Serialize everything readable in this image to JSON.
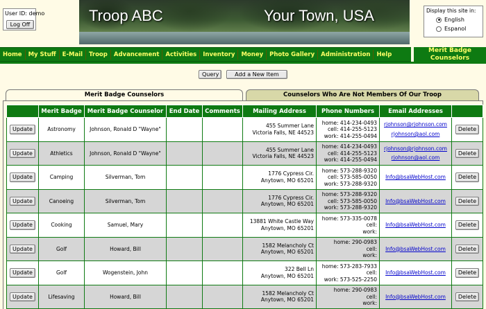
{
  "user": {
    "id_label": "User ID: demo",
    "logoff_label": "Log Off"
  },
  "banner": {
    "left_text": "Troop ABC",
    "right_text": "Your Town, USA"
  },
  "language": {
    "title": "Display this site in:",
    "options": [
      {
        "label": "English",
        "selected": true
      },
      {
        "label": "Espanol",
        "selected": false
      }
    ]
  },
  "nav": [
    "Home",
    "My Stuff",
    "E-Mail",
    "Troop",
    "Advancement",
    "Activities",
    "Inventory",
    "Money",
    "Photo Gallery",
    "Administration",
    "Help"
  ],
  "page_title": "Merit Badge Counselors",
  "actions": {
    "query_label": "Query",
    "add_label": "Add a New Item"
  },
  "tabs": [
    {
      "label": "Merit Badge Counselors",
      "active": true
    },
    {
      "label": "Counselors Who Are Not Members Of Our Troop",
      "active": false
    }
  ],
  "table": {
    "columns": [
      "",
      "Merit Badge",
      "Merit Badge Counselor",
      "End Date",
      "Comments",
      "Mailing Address",
      "Phone Numbers",
      "Email Addresses",
      ""
    ],
    "update_label": "Update",
    "delete_label": "Delete",
    "rows": [
      {
        "badge": "Astronomy",
        "counselor": "Johnson, Ronald D \"Wayne\"",
        "end_date": "",
        "comments": "",
        "addr1": "455 Summer Lane",
        "addr2": "Victoria Falls, NE  44523",
        "phones": [
          "home: 414-234-0493",
          "cell: 414-255-5123",
          "work: 414-255-0494"
        ],
        "emails": [
          "rjohnson@rjohnson.com",
          "rjohnson@aol.com"
        ]
      },
      {
        "badge": "Athletics",
        "counselor": "Johnson, Ronald D \"Wayne\"",
        "end_date": "",
        "comments": "",
        "addr1": "455 Summer Lane",
        "addr2": "Victoria Falls, NE  44523",
        "phones": [
          "home: 414-234-0493",
          "cell: 414-255-5123",
          "work: 414-255-0494"
        ],
        "emails": [
          "rjohnson@rjohnson.com",
          "rjohnson@aol.com"
        ]
      },
      {
        "badge": "Camping",
        "counselor": "Silverman, Tom",
        "end_date": "",
        "comments": "",
        "addr1": "1776 Cypress Cir.",
        "addr2": "Anytown, MO  65201",
        "phones": [
          "home: 573-288-9320",
          "cell: 573-585-0050",
          "work: 573-288-9320"
        ],
        "emails": [
          "Info@bsaWebHost.com"
        ]
      },
      {
        "badge": "Canoeing",
        "counselor": "Silverman, Tom",
        "end_date": "",
        "comments": "",
        "addr1": "1776 Cypress Cir.",
        "addr2": "Anytown, MO  65201",
        "phones": [
          "home: 573-288-9320",
          "cell: 573-585-0050",
          "work: 573-288-9320"
        ],
        "emails": [
          "Info@bsaWebHost.com"
        ]
      },
      {
        "badge": "Cooking",
        "counselor": "Samuel, Mary",
        "end_date": "",
        "comments": "",
        "addr1": "13881 White Castle Way",
        "addr2": "Anytown, MO  65201",
        "phones": [
          "home: 573-335-0078",
          "cell:",
          "work:"
        ],
        "emails": [
          "Info@bsaWebHost.com"
        ]
      },
      {
        "badge": "Golf",
        "counselor": "Howard, Bill",
        "end_date": "",
        "comments": "",
        "addr1": "1582 Melancholy Ct",
        "addr2": "Anytown, MO  65201",
        "phones": [
          "home: 290-0983",
          "cell:",
          "work:"
        ],
        "emails": [
          "Info@bsaWebHost.com"
        ]
      },
      {
        "badge": "Golf",
        "counselor": "Wogenstein, John",
        "end_date": "",
        "comments": "",
        "addr1": "322 Bell Ln",
        "addr2": "Anytown, MO  65201",
        "phones": [
          "home: 573-283-7933",
          "cell:",
          "work: 573-525-2250"
        ],
        "emails": [
          "Info@bsaWebHost.com"
        ]
      },
      {
        "badge": "Lifesaving",
        "counselor": "Howard, Bill",
        "end_date": "",
        "comments": "",
        "addr1": "1582 Melancholy Ct",
        "addr2": "Anytown, MO  65201",
        "phones": [
          "home: 290-0983",
          "cell:",
          "work:"
        ],
        "emails": [
          "Info@bsaWebHost.com"
        ]
      }
    ]
  }
}
